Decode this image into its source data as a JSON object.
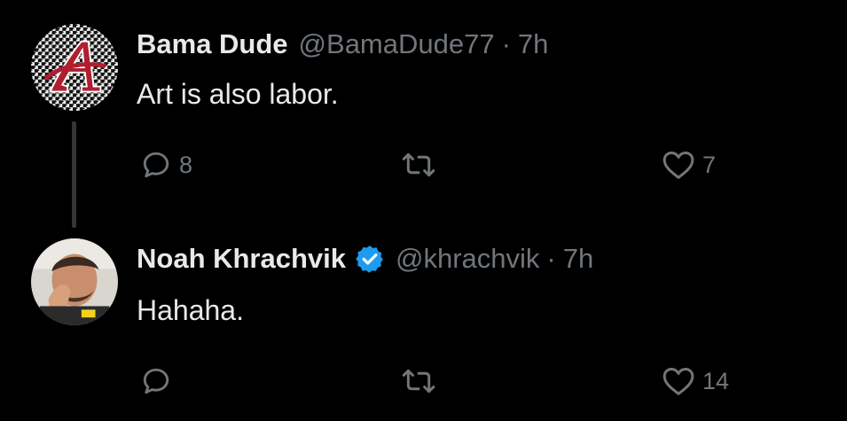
{
  "tweets": [
    {
      "author": "Bama Dude",
      "handle": "@BamaDude77",
      "separator": "·",
      "time": "7h",
      "text": "Art is also labor.",
      "verified": false,
      "avatar_icon": "alabama-script-a-houndstooth",
      "replies": "8",
      "retweets": "",
      "likes": "7"
    },
    {
      "author": "Noah Khrachvik",
      "handle": "@khrachvik",
      "separator": "·",
      "time": "7h",
      "text": "Hahaha.",
      "verified": true,
      "avatar_icon": "person-laughing-photo",
      "replies": "",
      "retweets": "",
      "likes": "14"
    }
  ],
  "colors": {
    "background": "#000000",
    "primary_text": "#e7e9ea",
    "secondary_text": "#71767b",
    "verified_badge": "#1d9bf0",
    "alabama_crimson": "#b01e2f",
    "thread_line": "#333639"
  }
}
